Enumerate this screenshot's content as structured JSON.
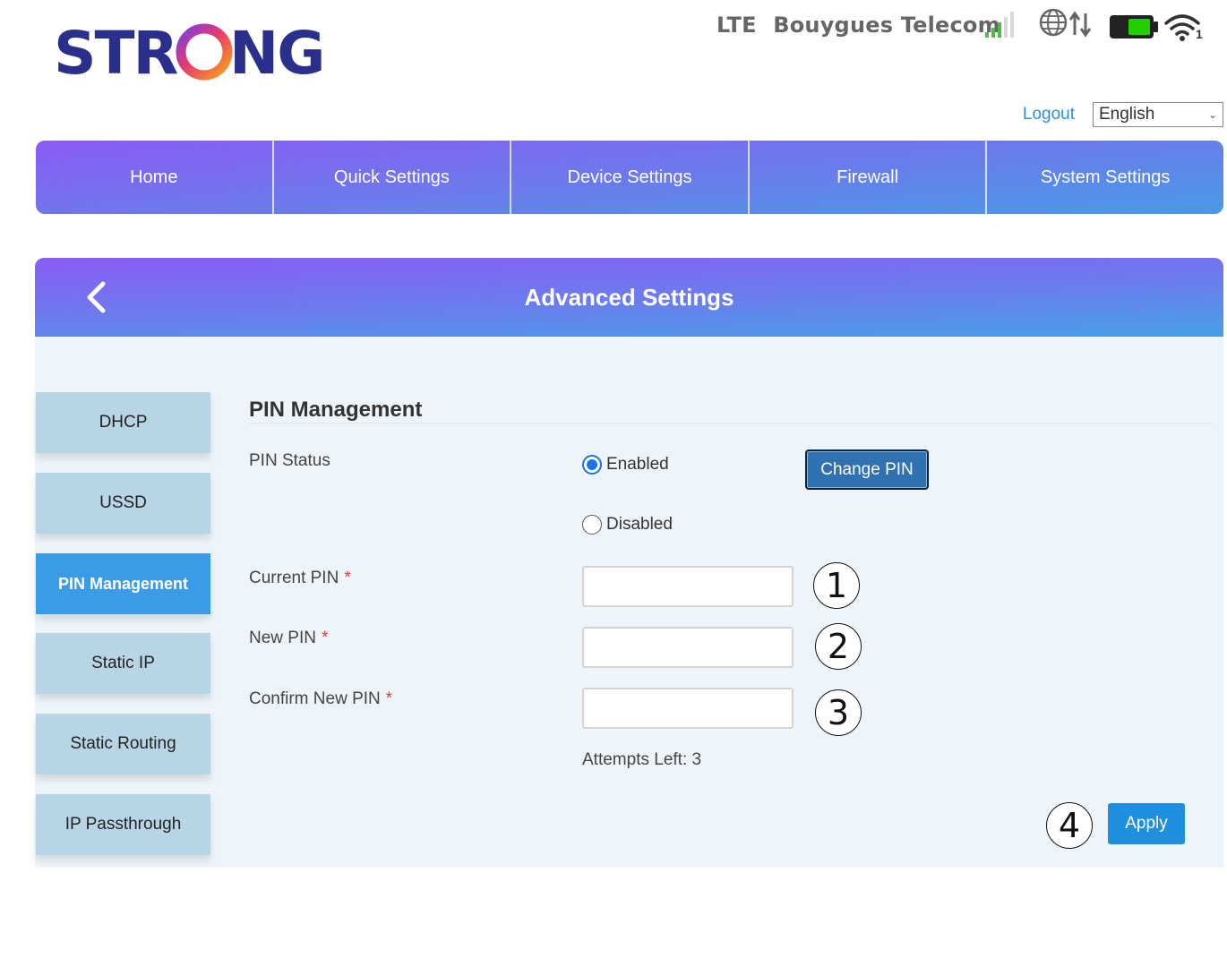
{
  "brand": {
    "logo_text": "STRONG"
  },
  "status": {
    "network_type": "LTE",
    "carrier": "Bouygues Telecom",
    "signal_icon": "signal-bars-icon",
    "data_icon": "globe-data-icon",
    "battery_icon": "battery-icon",
    "wifi_icon": "wifi-icon",
    "wifi_clients": "1",
    "colors": {
      "signal": "#55b84a",
      "battery": "#22d000"
    }
  },
  "topbar": {
    "logout": "Logout",
    "language": "English"
  },
  "nav": {
    "items": [
      "Home",
      "Quick Settings",
      "Device Settings",
      "Firewall",
      "System Settings"
    ]
  },
  "panel": {
    "title": "Advanced Settings"
  },
  "sidebar": {
    "items": [
      "DHCP",
      "USSD",
      "PIN Management",
      "Static IP",
      "Static Routing",
      "IP Passthrough"
    ],
    "active": "PIN Management"
  },
  "form": {
    "title": "PIN Management",
    "pin_status_label": "PIN Status",
    "enabled_label": "Enabled",
    "disabled_label": "Disabled",
    "pin_status_value": "Enabled",
    "change_pin": "Change PIN",
    "current_pin_label": "Current PIN",
    "new_pin_label": "New PIN",
    "confirm_pin_label": "Confirm New PIN",
    "required_mark": "*",
    "current_pin_value": "",
    "new_pin_value": "",
    "confirm_pin_value": "",
    "attempts_left": "Attempts Left: 3",
    "apply": "Apply"
  },
  "annotations": [
    "1",
    "2",
    "3",
    "4"
  ],
  "theme": {
    "accent": "#1f8fe0",
    "gradient_start": "#8a5cf5",
    "gradient_end": "#47a0e8",
    "logo_color": "#2a2f8c"
  }
}
